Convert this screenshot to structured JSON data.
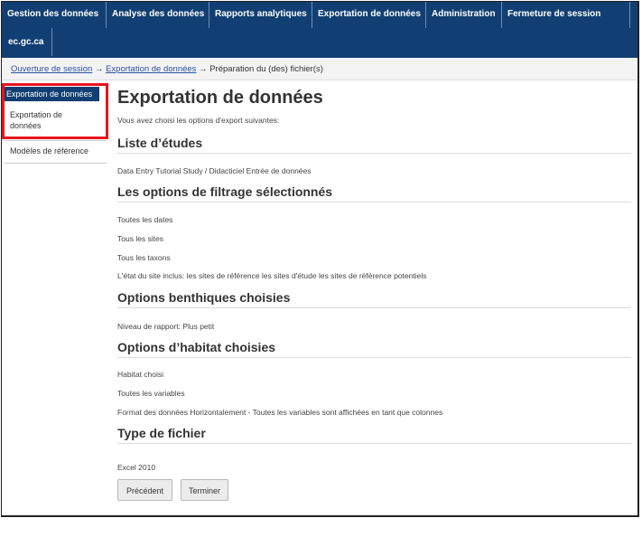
{
  "nav": {
    "items": [
      "Gestion des données",
      "Analyse des données",
      "Rapports analytiques",
      "Exportation de données",
      "Administration",
      "Fermeture de session"
    ],
    "second_row": "ec.gc.ca"
  },
  "breadcrumb": {
    "link1": "Ouverture de session",
    "arrow1": "→",
    "link2": "Exportation de données",
    "arrow2": "→",
    "current": "Préparation du (des) fichier(s)"
  },
  "sidebar": {
    "header": "Exportation de données",
    "item1": "Exportation de données",
    "item2": "Modèles de référence"
  },
  "main": {
    "title": "Exportation de données",
    "intro": "Vous avez choisi les options d'export suivantes:",
    "study_heading": "Liste d’études",
    "study_line": "Data Entry Tutorial Study / Didacticiel Entrée de données",
    "filter_heading": "Les options de filtrage sélectionnés",
    "filter_lines": [
      "Toutes les dates",
      "Tous les sites",
      "Tous les taxons",
      "L'état du site inclus: les sites de référence les sites d'étude les sites de référence potentiels"
    ],
    "benthic_heading": "Options benthiques choisies",
    "benthic_line": "Niveau de rapport: Plus petit",
    "habitat_heading": "Options d’habitat choisies",
    "habitat_lines": [
      "Habitat choisi",
      "Toutes les variables",
      "Format des données Horizontalement - Toutes les variables sont affichées en tant que colonnes"
    ],
    "file_heading": "Type de fichier",
    "file_line": "Excel 2010",
    "btn_previous": "Précédent",
    "btn_finish": "Terminer"
  },
  "colors": {
    "nav_bg": "#113f73",
    "highlight": "#e8141d",
    "link": "#2a51a4"
  }
}
